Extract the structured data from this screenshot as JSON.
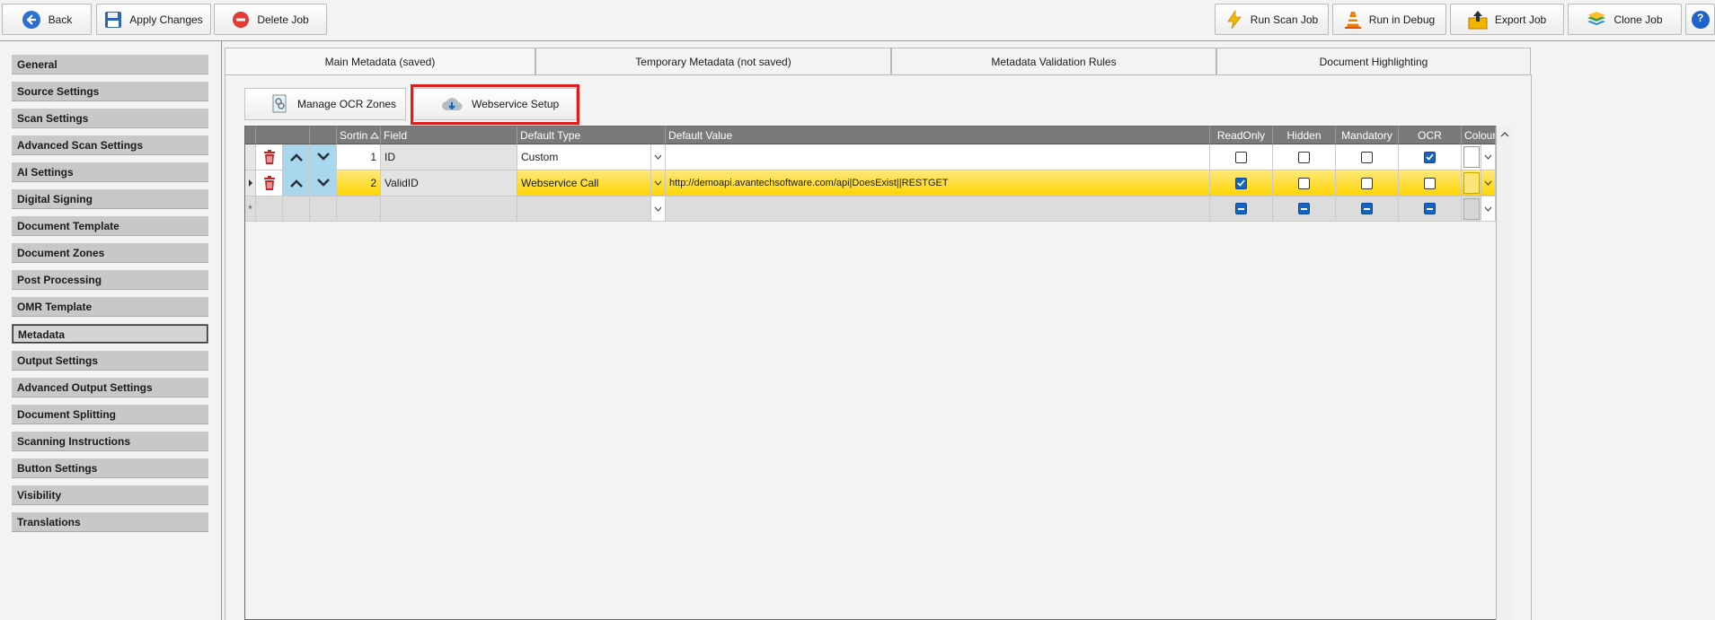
{
  "toolbar": {
    "back": "Back",
    "apply": "Apply Changes",
    "delete": "Delete Job",
    "run_scan": "Run Scan Job",
    "run_debug": "Run in Debug",
    "export": "Export Job",
    "clone": "Clone Job",
    "help": "?"
  },
  "sidebar": {
    "items": [
      {
        "label": "General"
      },
      {
        "label": "Source Settings"
      },
      {
        "label": "Scan Settings"
      },
      {
        "label": "Advanced Scan Settings"
      },
      {
        "label": "AI Settings"
      },
      {
        "label": "Digital Signing"
      },
      {
        "label": "Document Template"
      },
      {
        "label": "Document Zones"
      },
      {
        "label": "Post Processing"
      },
      {
        "label": "OMR Template"
      },
      {
        "label": "Metadata"
      },
      {
        "label": "Output Settings"
      },
      {
        "label": "Advanced Output Settings"
      },
      {
        "label": "Document Splitting"
      },
      {
        "label": "Scanning Instructions"
      },
      {
        "label": "Button Settings"
      },
      {
        "label": "Visibility"
      },
      {
        "label": "Translations"
      }
    ],
    "active": "Metadata"
  },
  "tabs": [
    {
      "label": "Main Metadata (saved)"
    },
    {
      "label": "Temporary Metadata (not saved)"
    },
    {
      "label": "Metadata Validation Rules"
    },
    {
      "label": "Document Highlighting"
    }
  ],
  "panel": {
    "manage_ocr": "Manage OCR Zones",
    "webservice": "Webservice Setup"
  },
  "grid": {
    "headers": {
      "sort": "Sortin",
      "field": "Field",
      "default_type": "Default Type",
      "default_value": "Default Value",
      "readonly": "ReadOnly",
      "hidden": "Hidden",
      "mandatory": "Mandatory",
      "ocr": "OCR",
      "colour": "Colour"
    },
    "rows": [
      {
        "sort": "1",
        "field": "ID",
        "default_type": "Custom",
        "default_value": "",
        "readonly": false,
        "hidden": false,
        "mandatory": false,
        "ocr": true
      },
      {
        "sort": "2",
        "field": "ValidID",
        "default_type": "Webservice Call",
        "default_value": "http://demoapi.avantechsoftware.com/api|DoesExist||RESTGET",
        "readonly": true,
        "hidden": false,
        "mandatory": false,
        "ocr": false
      }
    ],
    "new_row_marker": "*"
  },
  "colors": {
    "highlight": "#e01c1c",
    "selected_row": "#fdd400",
    "header": "#7a7a7a",
    "checkbox_on": "#1565c0",
    "delete_icon": "#c62828"
  }
}
